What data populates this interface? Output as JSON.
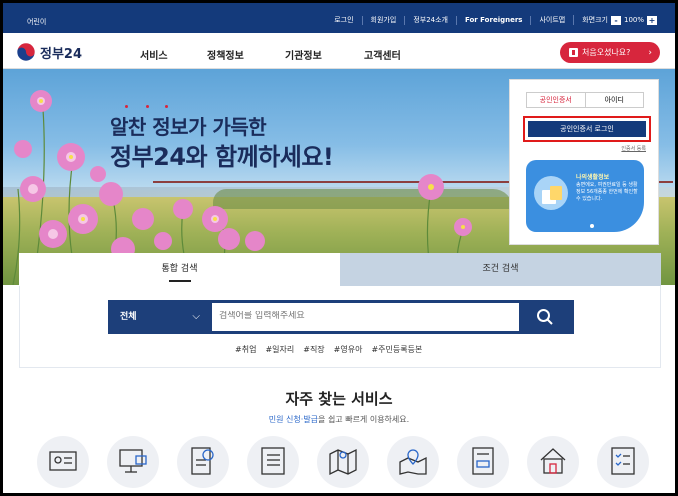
{
  "utility_bar": {
    "kids_label": "어린이",
    "links": [
      "로그인",
      "회원가입",
      "정부24소개",
      "For Foreigners",
      "사이트맵"
    ],
    "zoom_label": "화면크기",
    "zoom_minus": "-",
    "zoom_value": "100%",
    "zoom_plus": "+"
  },
  "header": {
    "logo_text": "정부24",
    "nav": [
      "서비스",
      "정책정보",
      "기관정보",
      "고객센터"
    ],
    "cta_label": "처음오셨나요?",
    "cta_arrow": "›"
  },
  "hero": {
    "title_line1": "알찬 정보가 가득한",
    "title_line2": "정부24와 함께하세요!"
  },
  "login": {
    "tab_cert": "공인인증서",
    "tab_id": "아이디",
    "button": "공인인증서 로그인",
    "cert_register": "인증서 등록",
    "card_title": "나의생활정보",
    "card_text": "송면에요, 여권만료일 등 생활정보 56개종종 한번에 확인할 수 있습니다."
  },
  "search": {
    "tab_integrated": "통합 검색",
    "tab_condition": "조건 검색",
    "select_value": "전체",
    "select_chevron": "⌵",
    "placeholder": "검색어를 입력해주세요",
    "tags": [
      "#취업",
      "#일자리",
      "#직장",
      "#영유아",
      "#주민등록등본"
    ]
  },
  "services": {
    "title": "자주 찾는 서비스",
    "subtitle_highlight": "민원 신청·발급",
    "subtitle_rest": "을 쉽고 빠르게 이용하세요.",
    "icons": [
      "id-card-icon",
      "computer-icon",
      "document-search-icon",
      "form-icon",
      "map-icon",
      "location-map-icon",
      "car-document-icon",
      "house-icon",
      "checklist-icon"
    ]
  },
  "colors": {
    "navy": "#143a7b",
    "accent_red": "#d7263d",
    "highlight_blue": "#2a67c9"
  }
}
